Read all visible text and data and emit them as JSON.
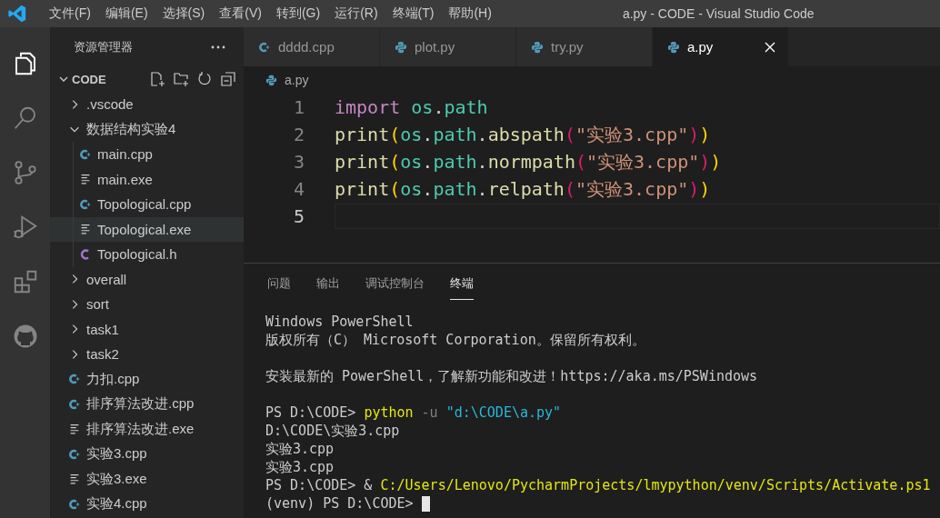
{
  "window": {
    "title": "a.py - CODE - Visual Studio Code"
  },
  "menu": [
    "文件(F)",
    "编辑(E)",
    "选择(S)",
    "查看(V)",
    "转到(G)",
    "运行(R)",
    "终端(T)",
    "帮助(H)"
  ],
  "activity_bar": [
    {
      "kind": "explorer",
      "selected": true
    },
    {
      "kind": "search",
      "selected": false
    },
    {
      "kind": "scm",
      "selected": false
    },
    {
      "kind": "debug",
      "selected": false
    },
    {
      "kind": "extensions",
      "selected": false
    },
    {
      "kind": "github",
      "selected": false
    }
  ],
  "sidebar": {
    "title": "资源管理器",
    "section": {
      "label": "CODE",
      "expanded": true
    },
    "tree": [
      {
        "label": ".vscode",
        "kind": "folder",
        "expanded": false,
        "selected": false
      },
      {
        "label": "数据结构实验4",
        "kind": "folder",
        "expanded": true,
        "selected": false,
        "children": [
          {
            "label": "main.cpp",
            "kind": "cpp",
            "selected": false
          },
          {
            "label": "main.exe",
            "kind": "exe",
            "selected": false
          },
          {
            "label": "Topological.cpp",
            "kind": "cpp",
            "selected": false
          },
          {
            "label": "Topological.exe",
            "kind": "exe",
            "selected": true
          },
          {
            "label": "Topological.h",
            "kind": "h",
            "selected": false
          }
        ]
      },
      {
        "label": "overall",
        "kind": "folder",
        "expanded": false,
        "selected": false
      },
      {
        "label": "sort",
        "kind": "folder",
        "expanded": false,
        "selected": false
      },
      {
        "label": "task1",
        "kind": "folder",
        "expanded": false,
        "selected": false
      },
      {
        "label": "task2",
        "kind": "folder",
        "expanded": false,
        "selected": false
      },
      {
        "label": "力扣.cpp",
        "kind": "cpp",
        "selected": false
      },
      {
        "label": "排序算法改进.cpp",
        "kind": "cpp",
        "selected": false
      },
      {
        "label": "排序算法改进.exe",
        "kind": "exe",
        "selected": false
      },
      {
        "label": "实验3.cpp",
        "kind": "cpp",
        "selected": false
      },
      {
        "label": "实验3.exe",
        "kind": "exe",
        "selected": false
      },
      {
        "label": "实验4.cpp",
        "kind": "cpp",
        "selected": false
      }
    ]
  },
  "tabs": [
    {
      "label": "dddd.cpp",
      "kind": "cpp",
      "selected": false
    },
    {
      "label": "plot.py",
      "kind": "py",
      "selected": false
    },
    {
      "label": "try.py",
      "kind": "py",
      "selected": false
    },
    {
      "label": "a.py",
      "kind": "py",
      "selected": true
    }
  ],
  "breadcrumb": {
    "label": "a.py",
    "kind": "py"
  },
  "code": [
    {
      "number": "1",
      "current": false,
      "tokens": [
        {
          "text": "import ",
          "kind": "keyword"
        },
        {
          "text": "os",
          "kind": "module"
        },
        {
          "text": ".",
          "kind": "plain"
        },
        {
          "text": "path",
          "kind": "module"
        }
      ]
    },
    {
      "number": "2",
      "current": false,
      "tokens": [
        {
          "text": "print",
          "kind": "func"
        },
        {
          "text": "(",
          "kind": "bracket1"
        },
        {
          "text": "os",
          "kind": "module"
        },
        {
          "text": ".",
          "kind": "plain"
        },
        {
          "text": "path",
          "kind": "module"
        },
        {
          "text": ".",
          "kind": "plain"
        },
        {
          "text": "abspath",
          "kind": "func"
        },
        {
          "text": "(",
          "kind": "bracket2"
        },
        {
          "text": "\"实验3.cpp\"",
          "kind": "string"
        },
        {
          "text": ")",
          "kind": "bracket2"
        },
        {
          "text": ")",
          "kind": "bracket1"
        }
      ]
    },
    {
      "number": "3",
      "current": false,
      "tokens": [
        {
          "text": "print",
          "kind": "func"
        },
        {
          "text": "(",
          "kind": "bracket1"
        },
        {
          "text": "os",
          "kind": "module"
        },
        {
          "text": ".",
          "kind": "plain"
        },
        {
          "text": "path",
          "kind": "module"
        },
        {
          "text": ".",
          "kind": "plain"
        },
        {
          "text": "normpath",
          "kind": "func"
        },
        {
          "text": "(",
          "kind": "bracket2"
        },
        {
          "text": "\"实验3.cpp\"",
          "kind": "string"
        },
        {
          "text": ")",
          "kind": "bracket2"
        },
        {
          "text": ")",
          "kind": "bracket1"
        }
      ]
    },
    {
      "number": "4",
      "current": false,
      "tokens": [
        {
          "text": "print",
          "kind": "func"
        },
        {
          "text": "(",
          "kind": "bracket1"
        },
        {
          "text": "os",
          "kind": "module"
        },
        {
          "text": ".",
          "kind": "plain"
        },
        {
          "text": "path",
          "kind": "module"
        },
        {
          "text": ".",
          "kind": "plain"
        },
        {
          "text": "relpath",
          "kind": "func"
        },
        {
          "text": "(",
          "kind": "bracket2"
        },
        {
          "text": "\"实验3.cpp\"",
          "kind": "string"
        },
        {
          "text": ")",
          "kind": "bracket2"
        },
        {
          "text": ")",
          "kind": "bracket1"
        }
      ]
    },
    {
      "number": "5",
      "current": true
    }
  ],
  "panel_tabs": [
    {
      "label": "问题",
      "selected": false
    },
    {
      "label": "输出",
      "selected": false
    },
    {
      "label": "调试控制台",
      "selected": false
    },
    {
      "label": "终端",
      "selected": true
    }
  ],
  "terminal": [
    {
      "blank_before": false,
      "cursor": false,
      "segments": [
        {
          "text": "Windows PowerShell",
          "kind": "plain"
        }
      ]
    },
    {
      "blank_before": false,
      "cursor": false,
      "segments": [
        {
          "text": "版权所有（C） Microsoft Corporation。保留所有权利。",
          "kind": "plain"
        }
      ]
    },
    {
      "blank_before": true,
      "cursor": false,
      "segments": [
        {
          "text": "安装最新的 PowerShell，了解新功能和改进！https://aka.ms/PSWindows",
          "kind": "plain"
        }
      ]
    },
    {
      "blank_before": true,
      "cursor": false,
      "segments": [
        {
          "text": "PS D:\\CODE> ",
          "kind": "plain"
        },
        {
          "text": "python",
          "kind": "command"
        },
        {
          "text": " -u ",
          "kind": "flag"
        },
        {
          "text": "\"d:\\CODE\\a.py\"",
          "kind": "string"
        }
      ]
    },
    {
      "blank_before": false,
      "cursor": false,
      "segments": [
        {
          "text": "D:\\CODE\\实验3.cpp",
          "kind": "plain"
        }
      ]
    },
    {
      "blank_before": false,
      "cursor": false,
      "segments": [
        {
          "text": "实验3.cpp",
          "kind": "plain"
        }
      ]
    },
    {
      "blank_before": false,
      "cursor": false,
      "segments": [
        {
          "text": "实验3.cpp",
          "kind": "plain"
        }
      ]
    },
    {
      "blank_before": false,
      "cursor": false,
      "segments": [
        {
          "text": "PS D:\\CODE> & ",
          "kind": "plain"
        },
        {
          "text": "C:/Users/Lenovo/PycharmProjects/lmypython/venv/Scripts/Activate.ps1",
          "kind": "command"
        }
      ]
    },
    {
      "blank_before": false,
      "cursor": true,
      "segments": [
        {
          "text": "(venv) PS D:\\CODE> ",
          "kind": "plain"
        }
      ]
    }
  ]
}
